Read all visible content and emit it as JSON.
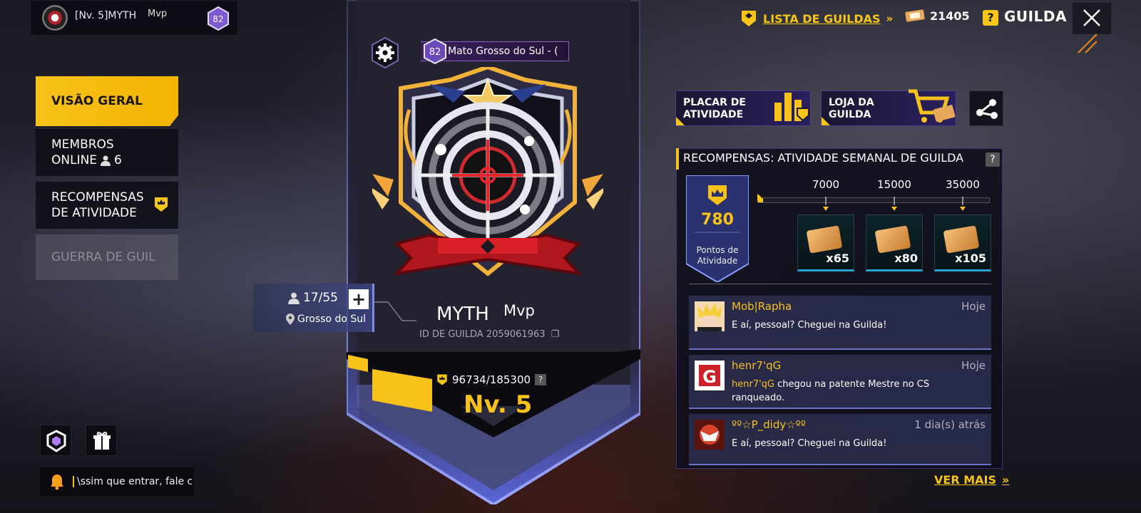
{
  "profile": {
    "name": "[Nv. 5]MYTH",
    "tag": "Mvp",
    "rank": "82"
  },
  "header": {
    "guild_list_label": "LISTA DE GUILDAS",
    "coins": "21405",
    "title": "GUILDA",
    "icons": [
      "guild-list-icon",
      "chevron-right-icon",
      "coupon-icon",
      "help-icon",
      "close-icon"
    ]
  },
  "nav": {
    "items": [
      {
        "label": "VISÃO GERAL",
        "active": true
      },
      {
        "label": "MEMBROS",
        "label2": "ONLINE",
        "count": "6"
      },
      {
        "label": "RECOMPENSAS",
        "label2": "DE ATIVIDADE"
      },
      {
        "label": "GUERRA DE GUIL",
        "disabled": true
      }
    ]
  },
  "notice": {
    "text": "\\ssim que entrar, fale c"
  },
  "guild": {
    "region": "Mato Grosso do Sul - (",
    "region_rank": "82",
    "name": "MYTH",
    "tag": "Mvp",
    "id_label": "ID DE GUILDA 2059061963",
    "xp": "96734/185300",
    "xp_current": 96734,
    "xp_max": 185300,
    "level": "Nv. 5",
    "members": "17/55",
    "member_region": "Grosso do Sul"
  },
  "actions": {
    "board": {
      "line1": "PLACAR DE",
      "line2": "ATIVIDADE"
    },
    "shop": {
      "line1": "LOJA DA",
      "line2": "GUILDA"
    }
  },
  "rewards": {
    "title": "RECOMPENSAS: ATIVIDADE SEMANAL DE GUILDA",
    "points": "780",
    "points_value": 780,
    "points_label1": "Pontos de",
    "points_label2": "Atividade",
    "milestones": [
      "7000",
      "15000",
      "35000"
    ],
    "milestone_values": [
      7000,
      15000,
      35000
    ],
    "items": [
      {
        "qty": "x65"
      },
      {
        "qty": "x80"
      },
      {
        "qty": "x105"
      }
    ]
  },
  "feed": [
    {
      "user": "Mob|Rapha",
      "time": "Hoje",
      "message": "E aí, pessoal? Cheguei na Guilda!"
    },
    {
      "user": "henr7'qG",
      "time": "Hoje",
      "highlight": "henr7'qG",
      "message": " chegou na patente Mestre no CS ranqueado."
    },
    {
      "user": "ºº☆P_didy☆ºº",
      "time": "1 dia(s) atrás",
      "message": "E aí, pessoal? Cheguei na Guilda!"
    }
  ],
  "see_more": "VER MAIS",
  "colors": {
    "accent": "#f7c21a",
    "panel": "#2b2060",
    "feed": "#3c406e"
  }
}
